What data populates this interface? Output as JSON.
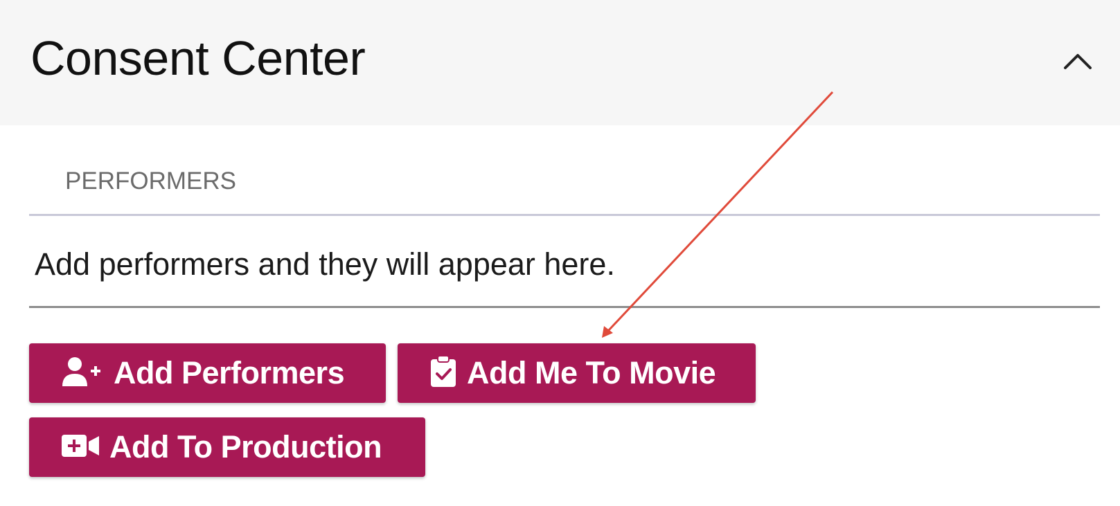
{
  "header": {
    "title": "Consent Center",
    "collapse_icon": "chevron-up-icon"
  },
  "tab": {
    "label": "PERFORMERS"
  },
  "performers": {
    "empty_message": "Add performers and they will appear here."
  },
  "actions": {
    "add_performers": {
      "label": "Add Performers",
      "icon": "user-plus-icon"
    },
    "add_me_to_movie": {
      "label": "Add Me To Movie",
      "icon": "clipboard-check-icon"
    },
    "add_to_production": {
      "label": "Add To Production",
      "icon": "video-plus-icon"
    }
  },
  "colors": {
    "header_bg": "#f6f6f6",
    "button_bg": "#a81955",
    "button_text": "#ffffff",
    "annotation_arrow": "#e04a3a"
  }
}
